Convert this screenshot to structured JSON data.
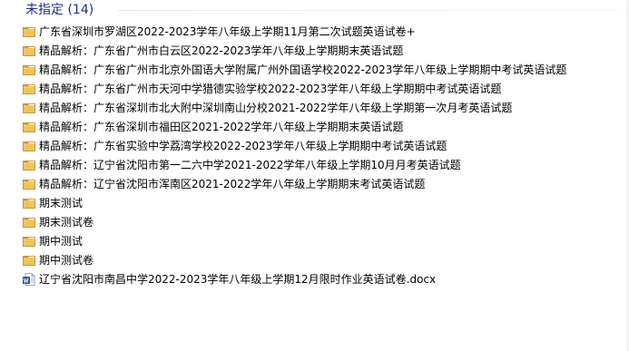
{
  "group": {
    "title": "未指定 (14)"
  },
  "items": [
    {
      "name": "广东省深圳市罗湖区2022-2023学年八年级上学期11月第二次试题英语试卷+",
      "type": "folder"
    },
    {
      "name": "精品解析：广东省广州市白云区2022-2023学年八年级上学期期末英语试题",
      "type": "folder"
    },
    {
      "name": "精品解析：广东省广州市北京外国语大学附属广州外国语学校2022-2023学年八年级上学期期中考试英语试题",
      "type": "folder"
    },
    {
      "name": "精品解析：广东省广州市天河中学猎德实验学校2022-2023学年八年级上学期期中考试英语试题",
      "type": "folder"
    },
    {
      "name": "精品解析：广东省深圳市北大附中深圳南山分校2021-2022学年八年级上学期第一次月考英语试题",
      "type": "folder"
    },
    {
      "name": "精品解析：广东省深圳市福田区2021-2022学年八年级上学期期末英语试题",
      "type": "folder"
    },
    {
      "name": "精品解析：广东省实验中学荔湾学校2022-2023学年八年级上学期期中考试英语试题",
      "type": "folder"
    },
    {
      "name": "精品解析：辽宁省沈阳市第一二六中学2021-2022学年八年级上学期10月月考英语试题",
      "type": "folder"
    },
    {
      "name": "精品解析：辽宁省沈阳市浑南区2021-2022学年八年级上学期期末考试英语试题",
      "type": "folder"
    },
    {
      "name": "期末测试",
      "type": "folder"
    },
    {
      "name": "期末测试卷",
      "type": "folder"
    },
    {
      "name": "期中测试",
      "type": "folder"
    },
    {
      "name": "期中测试卷",
      "type": "folder"
    },
    {
      "name": "辽宁省沈阳市南昌中学2022-2023学年八年级上学期12月限时作业英语试卷.docx",
      "type": "docx"
    }
  ],
  "icons": {
    "folder": "folder-icon",
    "docx": "word-document-icon"
  },
  "colors": {
    "group_title": "#1e3287",
    "folder_body": "#e8b64a",
    "folder_tab": "#d39d2c",
    "word_blue": "#2b5797"
  }
}
